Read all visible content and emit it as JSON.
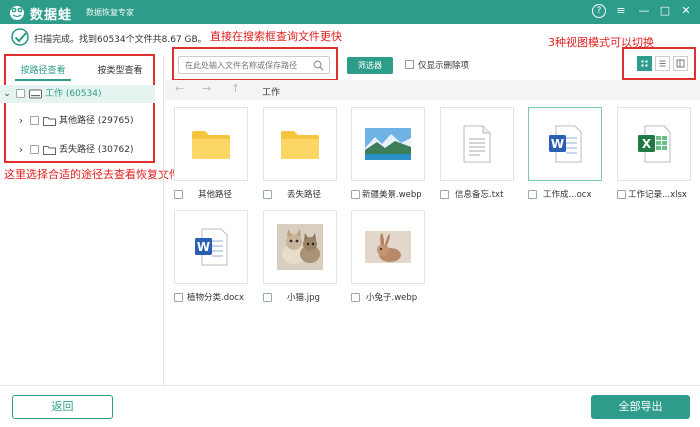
{
  "app": {
    "name": "数据蛙",
    "subtitle": "数据恢复专家"
  },
  "window": {
    "help": "?",
    "menu": "≡",
    "minimize": "—",
    "maximize": "□",
    "close": "✕"
  },
  "status": {
    "text": "扫描完成。找到60534个文件共8.67 GB。"
  },
  "annotations": {
    "search_tip": "直接在搜索框查询文件更快",
    "view_tip": "3种视图模式可以切换",
    "path_tip": "这里选择合适的途径去查看恢复文件"
  },
  "tabs": [
    {
      "label": "按路径查看"
    },
    {
      "label": "按类型查看"
    }
  ],
  "tree": [
    {
      "label": "工作 (60534)"
    },
    {
      "label": "其他路径 (29765)"
    },
    {
      "label": "丢失路径 (30762)"
    }
  ],
  "search": {
    "placeholder": "在此处输入文件名称或保存路径"
  },
  "filter": {
    "label": "筛选器"
  },
  "deleted_only": {
    "label": "仅显示删除项"
  },
  "breadcrumb": {
    "current": "工作"
  },
  "files": [
    {
      "name": "其他路径",
      "type": "folder"
    },
    {
      "name": "丢失路径",
      "type": "folder"
    },
    {
      "name": "新疆美景.webp",
      "type": "landscape"
    },
    {
      "name": "信息备忘.txt",
      "type": "txt"
    },
    {
      "name": "工作成...ocx",
      "type": "word"
    },
    {
      "name": "工作记录...xlsx",
      "type": "excel"
    },
    {
      "name": "植物分类.docx",
      "type": "word"
    },
    {
      "name": "小猫.jpg",
      "type": "cat"
    },
    {
      "name": "小兔子.webp",
      "type": "rabbit"
    }
  ],
  "footer": {
    "back": "返回",
    "export_all": "全部导出"
  },
  "colors": {
    "accent": "#2d9c8a",
    "annotation": "#e02020"
  }
}
